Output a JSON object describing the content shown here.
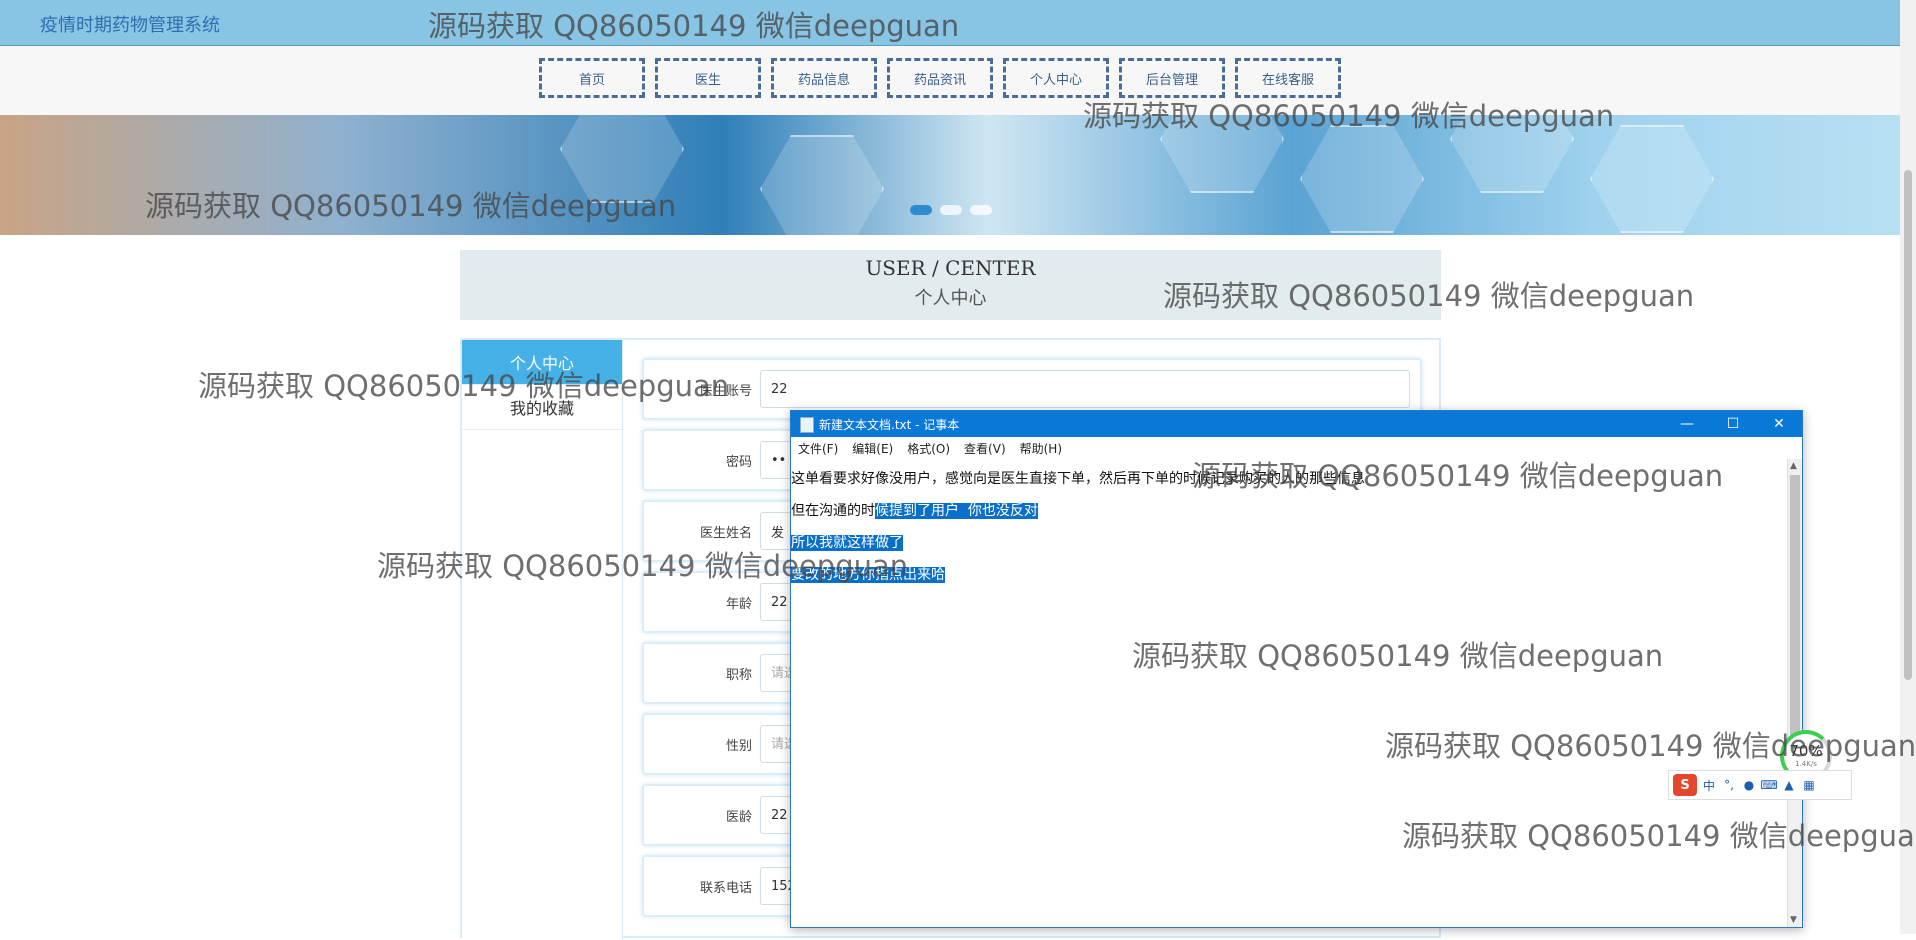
{
  "header": {
    "title": "疫情时期药物管理系统"
  },
  "nav": {
    "items": [
      "首页",
      "医生",
      "药品信息",
      "药品资讯",
      "个人中心",
      "后台管理",
      "在线客服"
    ]
  },
  "user_center": {
    "title_en": "USER / CENTER",
    "title_cn": "个人中心"
  },
  "sidebar": {
    "items": [
      {
        "label": "个人中心",
        "active": true
      },
      {
        "label": "我的收藏",
        "active": false
      }
    ]
  },
  "form": {
    "fields": [
      {
        "label": "医生账号",
        "value": "22",
        "placeholder": ""
      },
      {
        "label": "密码",
        "value": "••",
        "placeholder": ""
      },
      {
        "label": "医生姓名",
        "value": "发",
        "placeholder": ""
      },
      {
        "label": "年龄",
        "value": "22",
        "placeholder": ""
      },
      {
        "label": "职称",
        "value": "",
        "placeholder": "请选"
      },
      {
        "label": "性别",
        "value": "",
        "placeholder": "请选"
      },
      {
        "label": "医龄",
        "value": "22",
        "placeholder": ""
      },
      {
        "label": "联系电话",
        "value": "152",
        "placeholder": ""
      }
    ]
  },
  "notepad": {
    "title": "新建文本文档.txt - 记事本",
    "menu": [
      "文件(F)",
      "编辑(E)",
      "格式(O)",
      "查看(V)",
      "帮助(H)"
    ],
    "lines": [
      {
        "plain": "这单看要求好像没用户，感觉向是医生直接下单，然后再下单的时候记录购买的人的那些信息",
        "selected": ""
      },
      {
        "plain": "但在沟通的时",
        "selected": "候提到了用户  你也没反对"
      },
      {
        "plain": "",
        "selected": "所以我就这样做了"
      },
      {
        "plain": "",
        "selected": "要改的地方你指点出来哈"
      }
    ]
  },
  "ime": {
    "mode": "中"
  },
  "perf": {
    "value": "70%",
    "speed": "1.4K/s"
  },
  "watermark": {
    "text": "源码获取 QQ86050149 微信deepguan"
  }
}
